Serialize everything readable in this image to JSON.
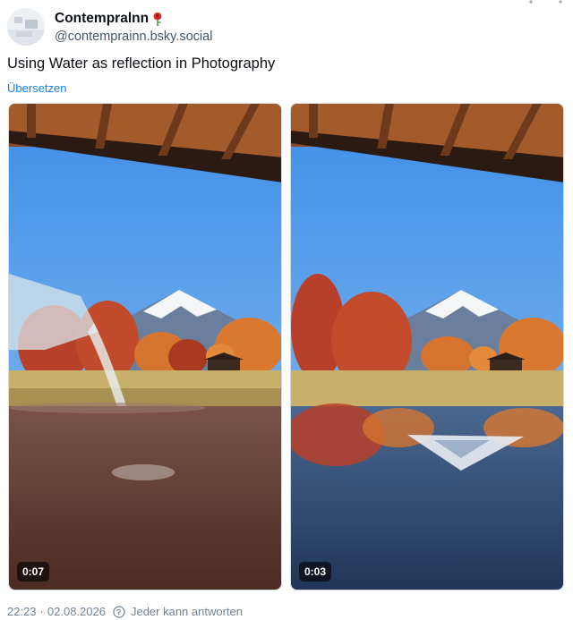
{
  "author": {
    "display_name": "Contempralnn",
    "handle": "@contemprainn.bsky.social",
    "badge_icon": "rose-icon"
  },
  "post": {
    "text": "Using Water as reflection in Photography",
    "translate_label": "Übersetzen"
  },
  "media": [
    {
      "duration": "0:07"
    },
    {
      "duration": "0:03"
    }
  ],
  "footer": {
    "time": "22:23",
    "separator": "·",
    "date": "02.08.2026",
    "reply_setting": "Jeder kann antworten"
  },
  "colors": {
    "link": "#1083fe",
    "muted": "#6f8396"
  }
}
